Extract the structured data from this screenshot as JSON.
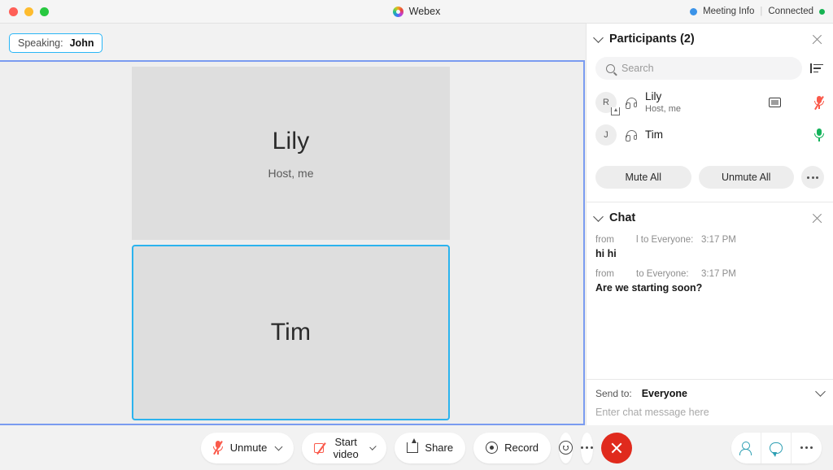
{
  "titlebar": {
    "app_name": "Webex",
    "meeting_info_label": "Meeting Info",
    "separator": "|",
    "connection_status": "Connected"
  },
  "speaking_badge": {
    "label": "Speaking:",
    "name": "John"
  },
  "stage": {
    "tiles": [
      {
        "name": "Lily",
        "subtitle": "Host, me",
        "active": false
      },
      {
        "name": "Tim",
        "subtitle": "",
        "active": true
      }
    ]
  },
  "participants_panel": {
    "title": "Participants (2)",
    "search_placeholder": "Search",
    "search_value": "",
    "rows": [
      {
        "avatar_letter": "R",
        "name": "Lily",
        "role": "Host, me",
        "mic_state": "muted",
        "has_video_badge": true
      },
      {
        "avatar_letter": "J",
        "name": "Tim",
        "role": "",
        "mic_state": "on",
        "has_video_badge": false
      }
    ],
    "mute_all_label": "Mute All",
    "unmute_all_label": "Unmute All"
  },
  "chat_panel": {
    "title": "Chat",
    "messages": [
      {
        "from_label": "from",
        "to_label": "l to Everyone:",
        "time": "3:17 PM",
        "body": "hi hi"
      },
      {
        "from_label": "from",
        "to_label": "to Everyone:",
        "time": "3:17 PM",
        "body": "Are we starting soon?"
      }
    ],
    "send_to_label": "Send to:",
    "send_to_value": "Everyone",
    "input_placeholder": "Enter chat message here",
    "input_value": ""
  },
  "controls": {
    "unmute_label": "Unmute",
    "start_video_label": "Start video",
    "share_label": "Share",
    "record_label": "Record"
  },
  "colors": {
    "accent_blue": "#7a9bf0",
    "active_tile": "#2bb3ee",
    "speaking_border": "#29b6f6",
    "mic_muted": "#fa5a4b",
    "mic_on": "#14b35b",
    "leave_red": "#e02a1d",
    "connected_green": "#16b352",
    "panel_icon_teal": "#2d9fb3"
  }
}
